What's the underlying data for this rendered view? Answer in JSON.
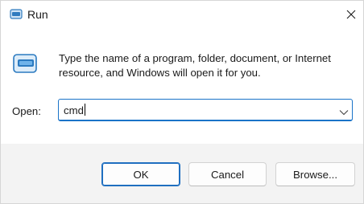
{
  "window": {
    "title": "Run",
    "title_icon": "run-icon",
    "close_icon": "close-icon"
  },
  "dialog": {
    "icon": "run-app-icon",
    "description": "Type the name of a program, folder, document, or Internet resource, and Windows will open it for you.",
    "open_label": "Open:",
    "open_value": "cmd",
    "dropdown_icon": "chevron-down-icon"
  },
  "buttons": {
    "ok_label": "OK",
    "cancel_label": "Cancel",
    "browse_label": "Browse..."
  },
  "colors": {
    "accent": "#1a73c8",
    "footer_bg": "#f3f3f3"
  }
}
